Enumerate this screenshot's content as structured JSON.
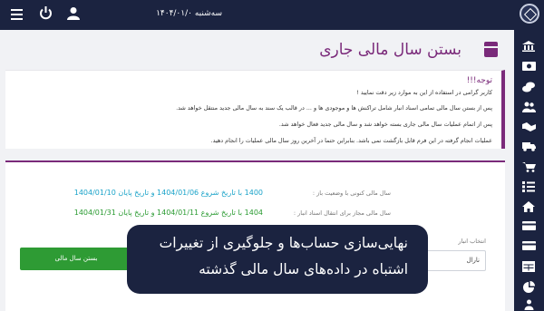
{
  "header": {
    "date": "سه‌شنبه ۱۴۰۴/۰۱/۰",
    "icons": [
      "menu-icon",
      "power-icon",
      "user-icon",
      "logo-icon"
    ],
    "background": "#1b2340"
  },
  "sidebar": {
    "icons": [
      "bank-icon",
      "money-icon",
      "coins-icon",
      "users-icon",
      "handshake-icon",
      "truck-icon",
      "shopping-cart-icon",
      "tasks-icon",
      "home-icon",
      "card-icon",
      "card-icon",
      "table-icon",
      "chart-pie-icon",
      "users-icon"
    ]
  },
  "page": {
    "title": "بستن سال مالی جاری",
    "accent": "#7a2a7a"
  },
  "warning": {
    "title": "توجه!!!",
    "lines": [
      "کاربر گرامی در استفاده از این به موارد زیر دقت نمایید !",
      "پس از بستن سال مالی تمامی اسناد انبار شامل تراکنش ها و موجودی ها و ... در قالب یک سند به سال مالی جدید منتقل خواهد شد.",
      "پس از اتمام عملیات سال مالی جاری بسته خواهد شد و سال مالی جدید فعال خواهد شد.",
      "عملیات انجام گرفته در این فرم قابل بازگشت نمی باشد. بنابراین حتما در آخرین روز سال مالی عملیات را انجام دهید."
    ]
  },
  "panel": {
    "current_label": "سال مالی کنونی با وضعیت باز :",
    "current_value": "1400 با تاریخ شروع 1404/01/06 و تاریخ پایان 1404/01/10",
    "allowed_label": "سال مالی مجاز برای انتقال اسناد انبار :",
    "allowed_value": "1404 با تاریخ شروع 1404/01/11 و تاریخ پایان 1404/01/31",
    "select_label": "انتخاب انبار",
    "select_value": "نارال",
    "close_button": "بستن سال مالی"
  },
  "banner": {
    "line1": "نهایی‌سازی حساب‌ها و جلوگیری از تغییرات",
    "line2": "اشتباه در داده‌های سال مالی گذشته"
  }
}
